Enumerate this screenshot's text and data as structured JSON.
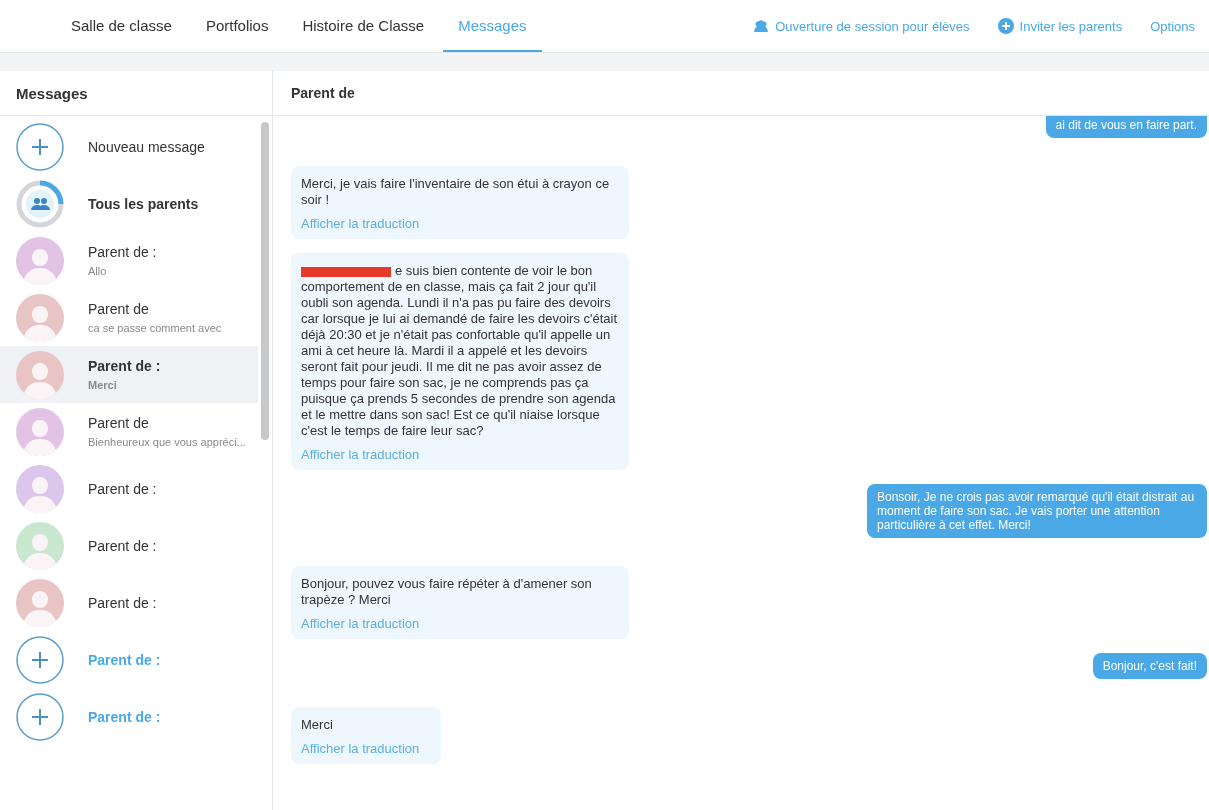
{
  "nav": {
    "tabs": [
      {
        "label": "Salle de classe",
        "selected": false
      },
      {
        "label": "Portfolios",
        "selected": false
      },
      {
        "label": "Histoire de Classe",
        "selected": false
      },
      {
        "label": "Messages",
        "selected": true
      }
    ],
    "actions": [
      {
        "kind": "students",
        "label": "Ouverture de session pour élèves"
      },
      {
        "kind": "invite",
        "label": "Inviter les parents"
      },
      {
        "kind": "plain",
        "label": "Options"
      }
    ]
  },
  "sidebar": {
    "title": "Messages",
    "items": [
      {
        "kind": "new",
        "name": "Nouveau message",
        "selected": false,
        "unread": false
      },
      {
        "kind": "group",
        "name": "Tous les parents",
        "selected": false,
        "unread": true
      },
      {
        "kind": "parent",
        "name": "Parent de :",
        "preview": "Allo",
        "color": "#e2c3e6",
        "selected": false,
        "unread": false
      },
      {
        "kind": "parent",
        "name": "Parent de",
        "preview": "ca se passe comment avec",
        "color": "#e8c4c4",
        "selected": false,
        "unread": false
      },
      {
        "kind": "parent",
        "name": "Parent de :",
        "preview": "Merci",
        "color": "#e8c4c4",
        "selected": true,
        "unread": true
      },
      {
        "kind": "parent",
        "name": "Parent de",
        "preview": "Bienheureux que vous appréci...",
        "color": "#e2c3e6",
        "selected": false,
        "unread": false
      },
      {
        "kind": "parent",
        "name": "Parent de :",
        "color": "#dcc6ec",
        "selected": false,
        "unread": false
      },
      {
        "kind": "parent",
        "name": "Parent de :",
        "color": "#c9e6cf",
        "selected": false,
        "unread": false
      },
      {
        "kind": "parent",
        "name": "Parent de :",
        "color": "#e8c4c4",
        "selected": false,
        "unread": false
      },
      {
        "kind": "invite",
        "name": "Parent de :",
        "selected": false
      },
      {
        "kind": "invite",
        "name": "Parent de :",
        "selected": false
      }
    ]
  },
  "conversation": {
    "title": "Parent de",
    "messages": [
      {
        "kind": "outgoing",
        "text": "ai dit de vous en faire part.",
        "cut_top": true
      },
      {
        "kind": "incoming",
        "text": "Merci, je vais faire l'inventaire de son étui à crayon ce soir !",
        "link": "Afficher la traduction"
      },
      {
        "kind": "incoming",
        "redacted_start": true,
        "text": "e suis bien contente de voir le bon comportement de en classe, mais ça fait 2 jour qu'il oubli son agenda. Lundi il n'a pas pu faire des devoirs car lorsque je lui ai demandé de faire les devoirs c'était déjà 20:30 et je n'était pas confortable qu'il appelle un ami à cet heure là. Mardi il a appelé et les devoirs seront fait pour jeudi. Il me dit ne pas avoir assez de temps pour faire son sac, je ne comprends pas ça puisque ça prends 5 secondes de prendre son agenda et le mettre dans son sac! Est ce qu'il niaise lorsque c'est le temps de faire leur sac?",
        "link": "Afficher la traduction"
      },
      {
        "kind": "outgoing",
        "text": "Bonsoir, Je ne crois pas avoir remarqué qu'il était distrait au moment de faire son sac. Je vais porter une attention particulière à cet effet. Merci!"
      },
      {
        "kind": "incoming",
        "text": "Bonjour, pouvez vous faire répéter à d'amener son trapèze ? Merci",
        "link": "Afficher la traduction"
      },
      {
        "kind": "outgoing",
        "text": "Bonjour, c'est fait!"
      },
      {
        "kind": "incoming",
        "text": "Merci",
        "link": "Afficher la traduction"
      }
    ]
  }
}
